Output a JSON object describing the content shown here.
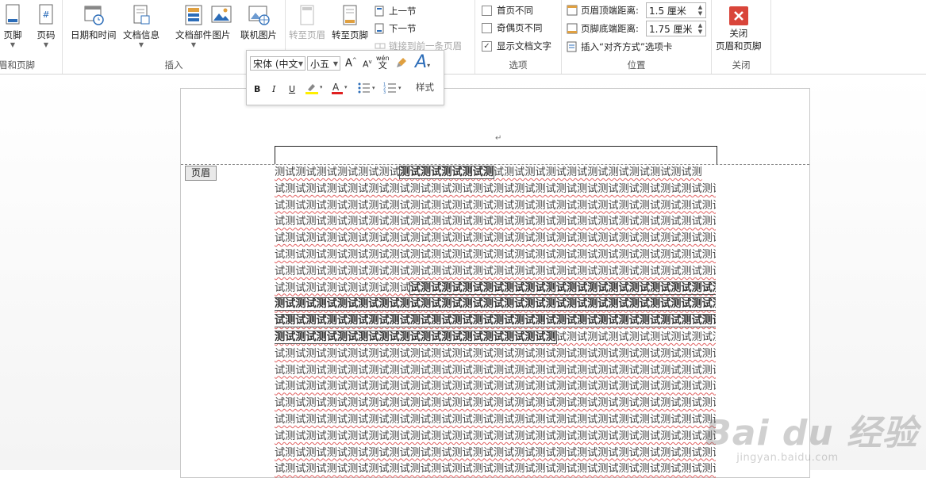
{
  "ribbon": {
    "groups": {
      "header_footer": {
        "label": "眉和页脚",
        "buttons": [
          {
            "label": "页脚"
          },
          {
            "label": "页码"
          }
        ]
      },
      "insert": {
        "label": "插入",
        "buttons": [
          {
            "label": "日期和时间"
          },
          {
            "label": "文档信息"
          },
          {
            "label": "文档部件"
          },
          {
            "label": "图片"
          },
          {
            "label": "联机图片"
          }
        ]
      },
      "navigation": {
        "goto_header": "转至页眉",
        "goto_footer": "转至页脚",
        "prev_section": "上一节",
        "next_section": "下一节",
        "link_previous": "链接到前一条页眉"
      },
      "options": {
        "label": "选项",
        "different_first": "首页不同",
        "different_odd_even": "奇偶页不同",
        "show_doc_text": "显示文档文字",
        "show_doc_text_checked": "✓"
      },
      "position": {
        "label": "位置",
        "header_from_top_label": "页眉顶端距离:",
        "header_from_top_value": "1.5 厘米",
        "footer_from_bottom_label": "页脚底端距离:",
        "footer_from_bottom_value": "1.75 厘米",
        "insert_alignment_tab": "插入“对齐方式”选项卡"
      },
      "close": {
        "label": "关闭",
        "button_label_line1": "关闭",
        "button_label_line2": "页眉和页脚"
      }
    }
  },
  "mini_toolbar": {
    "font_name": "宋体 (中文",
    "font_size": "小五",
    "grow_font": "A",
    "shrink_font": "A",
    "phonetic": "wén",
    "phonetic_char": "文",
    "styles_label": "样式",
    "bold": "B",
    "italic": "I",
    "underline": "U",
    "font_color": "A"
  },
  "document": {
    "header_tag": "页眉",
    "paragraph_mark": "↵",
    "lines": [
      {
        "plain": "测试测试测试测试测试测试",
        "sel": "测试测试测试测试测",
        "tail": "试测试测试测试测试测试测试测试测试测试测"
      },
      {
        "plain": "试测试测试测试测试测试测试测试测试测试测试测试测试测试测试测试测试测试测试测试测试测试测试测试测试测试测试测试测试测试测试测试测试"
      },
      {
        "plain": "试测试测试测试测试测试测试测试测试测试测试测试测试测试测试测试测试测试测试测试测试测试测试测试测试测试测试测试测试测试测试测试测试"
      },
      {
        "plain": "试测试测试测试测试测试测试测试测试测试测试测试测试测试测试测试测试测试测试测试测试测试测试测试测试测试测试测试测试测试测试测试测试"
      },
      {
        "plain": "试测试测试测试测试测试测试测试测试测试测试测试测试测试测试测试测试测试测试测试测试测试测试测试测试测试测试测试测试测试测试测试测试"
      },
      {
        "plain": "试测试测试测试测试测试测试测试测试测试测试测试测试测试测试测试测试测试测试测试测试测试测试测试测试测试测试测试测试测试测试测试测试"
      },
      {
        "plain": "试测试测试测试测试测试测试测试测试测试测试测试测试测试测试测试测试测试测试测试测试测试测试测试测试测试测试测试测试测试测试测试测试"
      },
      {
        "plain": "试测试测试测试测试测试测试",
        "sel": "试测试测试测试测试测试测试测试测试测试测试测试测试测试测试测试测试测试测试测试测试"
      },
      {
        "sel": "测试测试测试测试测试测试测试测试测试测试测试测试测试测试测试测试测试测试测试测试测试测试测试测试测试测试测试测试测试测"
      },
      {
        "sel": "试测试测试测试测试测试测试测试测试测试测试测试测试测试测试测试测试测试测试测试测试测试测试测试测试测试测试测试测试"
      },
      {
        "sel": "测试测试测试测试测试测试测试测试测试测试测试测试测试测",
        "tail": "试测试测试测试测试测试测试测试测试测试测试测试测试测试测试测试测试测试"
      },
      {
        "plain": "试测试测试测试测试测试测试测试测试测试测试测试测试测试测试测试测试测试测试测试测试测试测试测试测试测试测试测试测试测试测试测试测试"
      },
      {
        "plain": "试测试测试测试测试测试测试测试测试测试测试测试测试测试测试测试测试测试测试测试测试测试测试测试测试测试测试测试测试测试测试测试测试"
      },
      {
        "plain": "试测试测试测试测试测试测试测试测试测试测试测试测试测试测试测试测试测试测试测试测试测试测试测试测试测试测试测试测试测试测试测试测试"
      },
      {
        "plain": "试测试测试测试测试测试测试测试测试测试测试测试测试测试测试测试测试测试测试测试测试测试测试测试测试测试测试测试测试测试测试测试测试"
      },
      {
        "plain": "试测试测试测试测试测试测试测试测试测试测试测试测试测试测试测试测试测试测试测试测试测试测试测试测试测试测试测试测试测试测试测试测试"
      },
      {
        "plain": "试测试测试测试测试测试测试测试测试测试测试测试测试测试测试测试测试测试测试测试测试测试测试测试测试测试测试测试测试测试测试测试测试"
      },
      {
        "plain": "试测试测试测试测试测试测试测试测试测试测试测试测试测试测试测试测试测试测试测试测试测试测试测试测试测试测试测试测试测试测试测试测试"
      },
      {
        "plain": "试测试测试测试测试测试测试测试测试测试测试测试测试测试测试测试测试测试测试测试测试测试测试测试测试测试测试测试测试测试测试测试测试"
      }
    ]
  },
  "watermark": {
    "brand": "Bai du 经验",
    "url": "jingyan.baidu.com"
  },
  "colors": {
    "close_red": "#d9453a",
    "accent_blue": "#2b6cb8",
    "squiggle": "#e06060"
  }
}
